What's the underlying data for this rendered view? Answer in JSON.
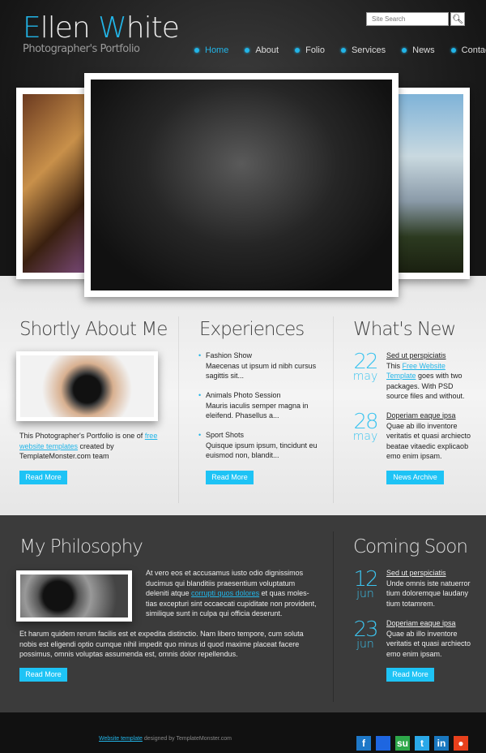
{
  "header": {
    "logo_first": "E",
    "logo_mid": "llen ",
    "logo_w": "W",
    "logo_rest": "hite",
    "tagline": "Photographer's Portfolio",
    "search_placeholder": "Site Search",
    "nav": [
      "Home",
      "About",
      "Folio",
      "Services",
      "News",
      "Contact"
    ],
    "active": "Home",
    "accent": "#22b5e8"
  },
  "about": {
    "title": "Shortly About Me",
    "text1": "This Photographer's Portfolio is one of ",
    "link": "free website templates",
    "text2": " created by TemplateMonster.com team",
    "button": "Read More"
  },
  "experiences": {
    "title": "Experiences",
    "items": [
      {
        "title": "Fashion Show",
        "text": "Maecenas ut ipsum id nibh cursus sagittis sit..."
      },
      {
        "title": "Animals Photo Session",
        "text": "Mauris iaculis semper magna in eleifend. Phasellus a..."
      },
      {
        "title": "Sport Shots",
        "text": "Quisque ipsum ipsum, tincidunt eu euismod non, blandit..."
      }
    ],
    "button": "Read More"
  },
  "news": {
    "title": "What's New",
    "items": [
      {
        "day": "22",
        "month": "may",
        "title": "Sed ut perspiciatis",
        "pre": "This ",
        "link": "Free Website Template",
        "text": " goes with two packages. With PSD source files and without."
      },
      {
        "day": "28",
        "month": "may",
        "title": "Doperiam eaque ipsa",
        "text": "Quae ab illo inventore veritatis et quasi archiecto beatae vitaedic explicaob emo enim ipsam."
      }
    ],
    "button": "News Archive"
  },
  "philosophy": {
    "title": "My Philosophy",
    "p1a": "At vero eos et accusamus iusto odio dignissimos ducimus qui blanditiis praesentium voluptatum deleniti atque ",
    "p1link": "corrupti quos dolores",
    "p1b": " et quas moles- tias excepturi sint occaecati cupiditate non provident, similique sunt in culpa qui officia deserunt.",
    "p2": "Et harum quidem rerum facilis est et expedita distinctio. Nam libero tempore, cum soluta nobis est eligendi optio cumque nihil impedit quo minus id quod maxime placeat facere possimus, omnis voluptas assumenda est, omnis dolor repellendus.",
    "button": "Read More"
  },
  "coming": {
    "title": "Coming Soon",
    "items": [
      {
        "day": "12",
        "month": "jun",
        "title": "Sed ut perspiciatis",
        "text": "Unde omnis iste natuerror tium doloremque laudany tium totamrem."
      },
      {
        "day": "23",
        "month": "jun",
        "title": "Doperiam eaque ipsa",
        "text": "Quae ab illo inventore veritatis et quasi archiecto emo enim ipsam."
      }
    ],
    "button": "Read More"
  },
  "footer": {
    "link": "Website template",
    "text": " designed by TemplateMonster.com",
    "social": [
      {
        "name": "facebook-icon",
        "glyph": "f",
        "color": "#1e78c8"
      },
      {
        "name": "delicious-icon",
        "glyph": "",
        "color": "#1e66e0"
      },
      {
        "name": "stumbleupon-icon",
        "glyph": "su",
        "color": "#2ea84a"
      },
      {
        "name": "twitter-icon",
        "glyph": "t",
        "color": "#2aa8e8"
      },
      {
        "name": "linkedin-icon",
        "glyph": "in",
        "color": "#1a78c0"
      },
      {
        "name": "reddit-icon",
        "glyph": "●",
        "color": "#e8401c"
      }
    ]
  }
}
